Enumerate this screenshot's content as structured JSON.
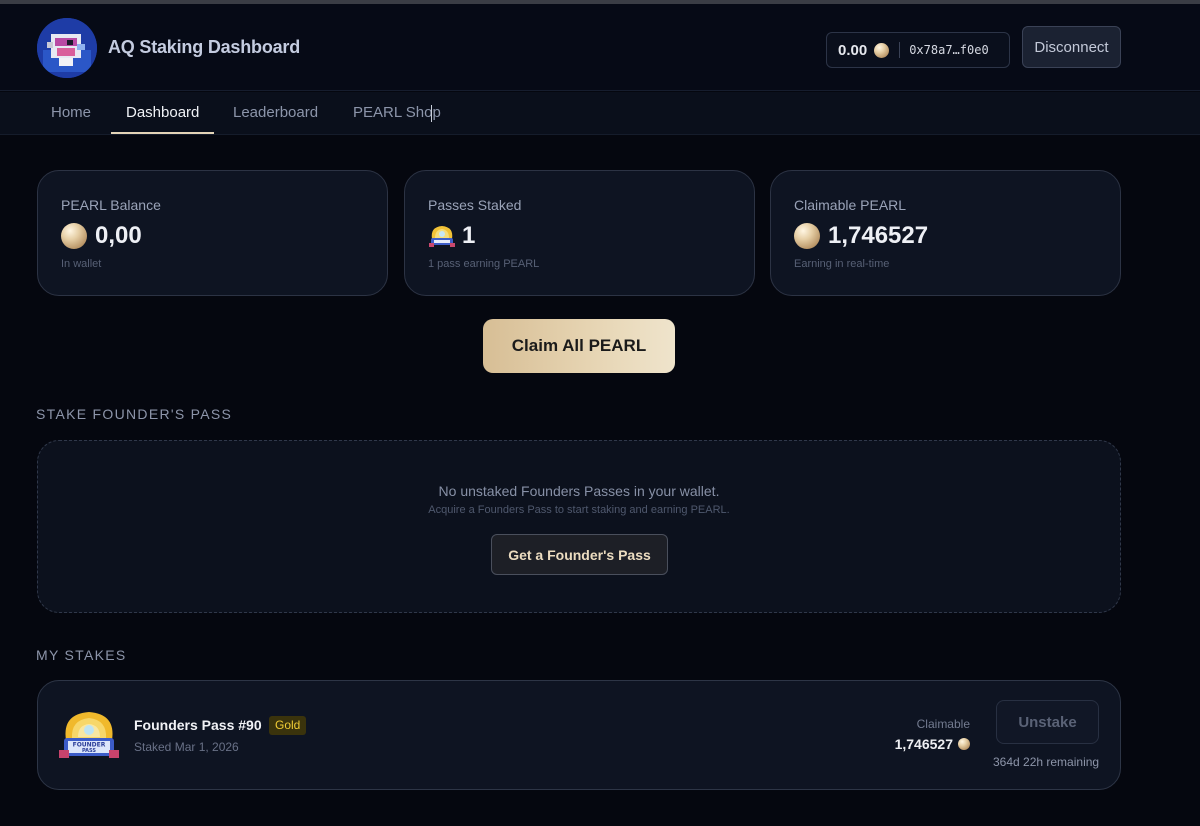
{
  "header": {
    "title": "AQ Staking Dashboard",
    "wallet_balance": "0.00",
    "wallet_address": "0x78a7…f0e0",
    "disconnect_label": "Disconnect"
  },
  "nav": {
    "tabs": [
      {
        "label": "Home",
        "active": false
      },
      {
        "label": "Dashboard",
        "active": true
      },
      {
        "label": "Leaderboard",
        "active": false
      },
      {
        "label": "PEARL Shop",
        "active": false
      }
    ]
  },
  "stats": [
    {
      "label": "PEARL Balance",
      "value": "0,00",
      "sub": "In wallet",
      "icon": "pearl-icon"
    },
    {
      "label": "Passes Staked",
      "value": "1",
      "sub": "1 pass earning PEARL",
      "icon": "founders-pass-icon"
    },
    {
      "label": "Claimable PEARL",
      "value": "1,746527",
      "sub": "Earning in real-time",
      "icon": "pearl-icon"
    }
  ],
  "claim_all_label": "Claim All PEARL",
  "stake_section": {
    "title": "STAKE FOUNDER'S PASS",
    "empty_title": "No unstaked Founders Passes in your wallet.",
    "empty_sub": "Acquire a Founders Pass to start staking and earning PEARL.",
    "button_label": "Get a Founder's Pass"
  },
  "my_stakes": {
    "title": "MY STAKES",
    "items": [
      {
        "name": "Founders Pass #90",
        "tier": "Gold",
        "staked": "Staked Mar 1, 2026",
        "claimable_label": "Claimable",
        "claimable": "1,746527",
        "unstake_label": "Unstake",
        "remaining": "364d 22h remaining"
      }
    ]
  },
  "colors": {
    "background": "#05070f",
    "card": "#0e1422",
    "accent_gold": "#e4d4b7",
    "badge_gold": "#f0cc35"
  }
}
